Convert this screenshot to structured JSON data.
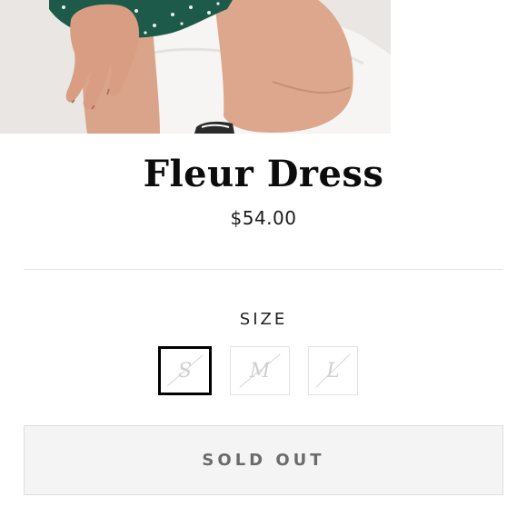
{
  "product": {
    "image_alt": "model wearing green floral dress",
    "title": "Fleur Dress",
    "price": "$54.00"
  },
  "size_selector": {
    "label": "SIZE",
    "options": [
      {
        "label": "S",
        "selected": true,
        "available": false
      },
      {
        "label": "M",
        "selected": false,
        "available": false
      },
      {
        "label": "L",
        "selected": false,
        "available": false
      }
    ]
  },
  "purchase": {
    "button_label": "SOLD OUT"
  },
  "colors": {
    "dress_green": "#1d5a4a",
    "selected_border": "#000000",
    "button_bg": "#f4f4f4",
    "button_text": "#6b6b6b"
  }
}
